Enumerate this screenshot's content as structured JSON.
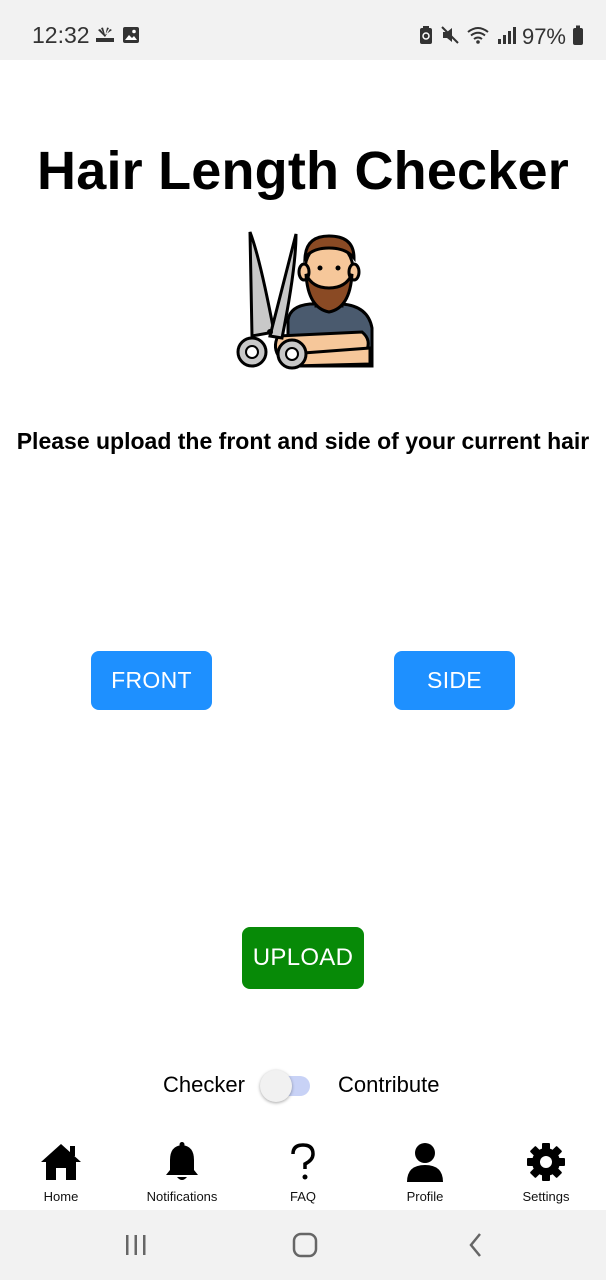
{
  "status_bar": {
    "time": "12:32",
    "battery_percent": "97%",
    "icons": [
      "cnbc-icon",
      "gallery-icon",
      "battery-saver-icon",
      "mute-icon",
      "wifi-icon",
      "signal-icon",
      "battery-icon"
    ]
  },
  "page": {
    "title": "Hair Length Checker",
    "illustration": "barber-scissors-icon",
    "instructions": "Please upload the front and side of your current hair"
  },
  "buttons": {
    "front": "FRONT",
    "side": "SIDE",
    "upload": "UPLOAD"
  },
  "mode_toggle": {
    "left_label": "Checker",
    "right_label": "Contribute",
    "state": "off"
  },
  "tab_bar": {
    "items": [
      {
        "label": "Home",
        "icon": "home-icon"
      },
      {
        "label": "Notifications",
        "icon": "bell-icon"
      },
      {
        "label": "FAQ",
        "icon": "question-icon"
      },
      {
        "label": "Profile",
        "icon": "person-icon"
      },
      {
        "label": "Settings",
        "icon": "gear-icon"
      }
    ]
  },
  "colors": {
    "primary_button": "#1e90ff",
    "upload_button": "#078a07",
    "toggle_track": "#c8d2f6"
  }
}
